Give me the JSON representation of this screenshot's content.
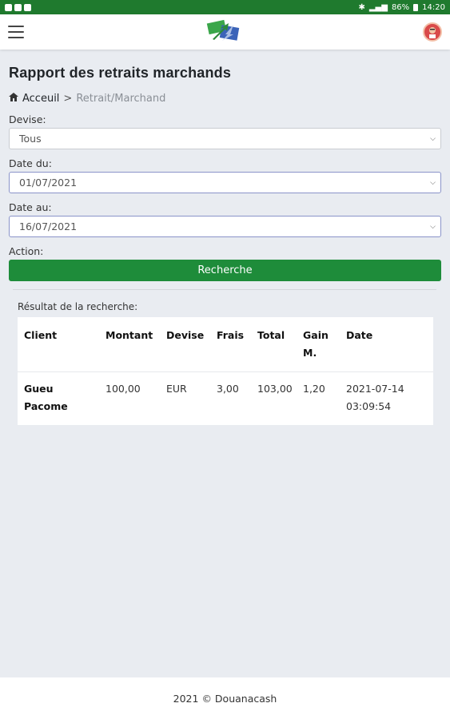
{
  "status_bar": {
    "battery": "86%",
    "time": "14:20"
  },
  "header": {
    "menu_icon": "hamburger-menu-icon",
    "logo": "douanacash-logo",
    "avatar_icon": "user-avatar-icon"
  },
  "page": {
    "title": "Rapport des retraits marchands",
    "breadcrumb": {
      "home_icon": "home-icon",
      "home_label": "Acceuil",
      "separator": ">",
      "current": "Retrait/Marchand"
    }
  },
  "form": {
    "devise_label": "Devise:",
    "devise_value": "Tous",
    "date_from_label": "Date du:",
    "date_from_value": "01/07/2021",
    "date_to_label": "Date au:",
    "date_to_value": "16/07/2021",
    "action_label": "Action:",
    "search_button": "Recherche"
  },
  "results": {
    "label": "Résultat de la recherche:",
    "columns": [
      "Client",
      "Montant",
      "Devise",
      "Frais",
      "Total",
      "Gain M.",
      "Date"
    ],
    "rows": [
      {
        "client": "Gueu Pacome",
        "montant": "100,00",
        "devise": "EUR",
        "frais": "3,00",
        "total": "103,00",
        "gain": "1,20",
        "date": "2021-07-14 03:09:54"
      }
    ]
  },
  "footer": {
    "text": "2021 © Douanacash"
  },
  "colors": {
    "status_bar": "#1f7a2e",
    "button": "#1e8c3a",
    "background": "#e9ecf1"
  }
}
